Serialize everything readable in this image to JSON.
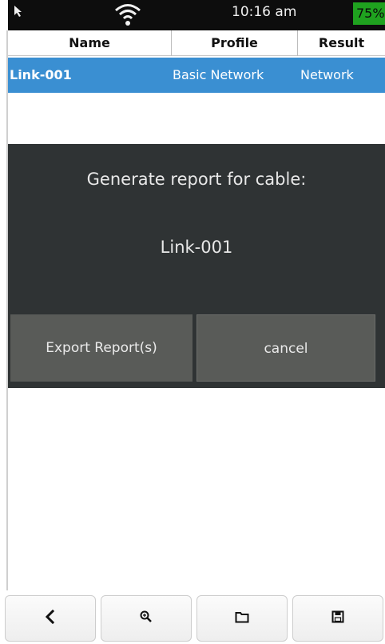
{
  "status_bar": {
    "time": "10:16 am",
    "battery": "75%",
    "battery_color": "#1fa21f",
    "icons": [
      "cursor-icon",
      "wifi-icon"
    ]
  },
  "table": {
    "columns": [
      "Name",
      "Profile",
      "Result"
    ],
    "rows": [
      {
        "name": "Link-001",
        "profile": "Basic Network",
        "result": "Network",
        "selected": true
      }
    ],
    "selected_color": "#3a8fd2"
  },
  "dialog": {
    "title": "Generate report for cable:",
    "cable": "Link-001",
    "export_label": "Export Report(s)",
    "cancel_label": "cancel"
  },
  "toolbar": {
    "buttons": [
      "back-icon",
      "zoom-icon",
      "folder-icon",
      "save-icon"
    ]
  }
}
